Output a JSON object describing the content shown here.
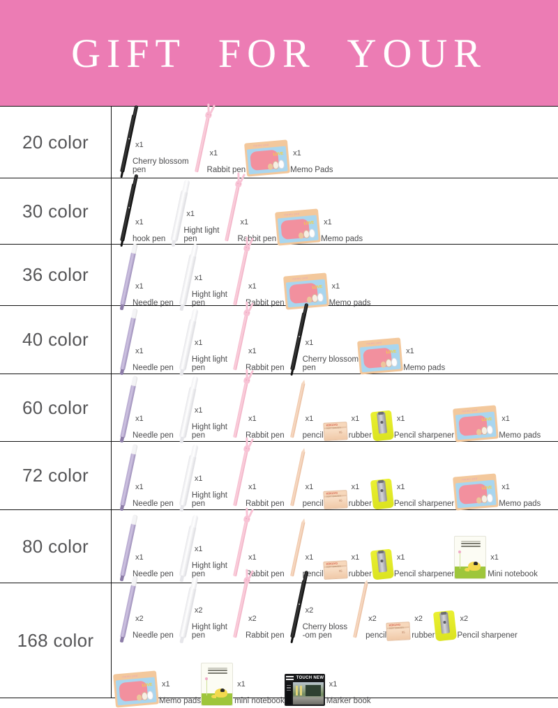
{
  "header": {
    "title": "GIFT  FOR  YOUR",
    "background_color": "#ec7cb4",
    "text_color": "#ffffff"
  },
  "table": {
    "rows": [
      {
        "label": "20 color",
        "lines": [
          [
            {
              "art": "cherry",
              "qty": "x1",
              "name": "Cherry blossom\npen"
            },
            {
              "art": "rabbit",
              "qty": "x1",
              "name": "Rabbit pen"
            },
            {
              "art": "memo",
              "qty": "x1",
              "name": "Memo Pads"
            }
          ]
        ]
      },
      {
        "label": "30 color",
        "lines": [
          [
            {
              "art": "cherry",
              "qty": "x1",
              "name": "hook pen"
            },
            {
              "art": "hlight",
              "qty": "x1",
              "name": "Hight light\npen"
            },
            {
              "art": "rabbit",
              "qty": "x1",
              "name": "Rabbit pen"
            },
            {
              "art": "memo",
              "qty": "x1",
              "name": "Memo pads"
            }
          ]
        ]
      },
      {
        "label": "36 color",
        "lines": [
          [
            {
              "art": "needle",
              "qty": "x1",
              "name": "Needle pen"
            },
            {
              "art": "hlight",
              "qty": "x1",
              "name": "Hight light\npen"
            },
            {
              "art": "rabbit",
              "qty": "x1",
              "name": "Rabbit pen"
            },
            {
              "art": "memo",
              "qty": "x1",
              "name": "Memo pads"
            }
          ]
        ]
      },
      {
        "label": "40 color",
        "lines": [
          [
            {
              "art": "needle",
              "qty": "x1",
              "name": "Needle pen"
            },
            {
              "art": "hlight",
              "qty": "x1",
              "name": "Hight light\npen"
            },
            {
              "art": "rabbit",
              "qty": "x1",
              "name": "Rabbit pen"
            },
            {
              "art": "cherry",
              "qty": "x1",
              "name": "Cherry blossom\npen"
            },
            {
              "art": "memo",
              "qty": "x1",
              "name": "Memo pads"
            }
          ]
        ]
      },
      {
        "label": "60 color",
        "lines": [
          [
            {
              "art": "needle",
              "qty": "x1",
              "name": "Needle pen"
            },
            {
              "art": "hlight",
              "qty": "x1",
              "name": "Hight light\npen"
            },
            {
              "art": "rabbit",
              "qty": "x1",
              "name": "Rabbit pen"
            },
            {
              "art": "pencil",
              "qty": "x1",
              "name": "pencil"
            },
            {
              "art": "rubber",
              "qty": "x1",
              "name": "rubber"
            },
            {
              "art": "sharp",
              "qty": "x1",
              "name": "Pencil sharpener"
            },
            {
              "art": "memo",
              "qty": "x1",
              "name": "Memo pads"
            }
          ]
        ]
      },
      {
        "label": "72 color",
        "lines": [
          [
            {
              "art": "needle",
              "qty": "x1",
              "name": "Needle pen"
            },
            {
              "art": "hlight",
              "qty": "x1",
              "name": "Hight light\npen"
            },
            {
              "art": "rabbit",
              "qty": "x1",
              "name": "Rabbit pen"
            },
            {
              "art": "pencil",
              "qty": "x1",
              "name": "pencil"
            },
            {
              "art": "rubber",
              "qty": "x1",
              "name": "rubber"
            },
            {
              "art": "sharp",
              "qty": "x1",
              "name": "Pencil sharpener"
            },
            {
              "art": "memo",
              "qty": "x1",
              "name": "Memo pads"
            }
          ]
        ]
      },
      {
        "label": "80 color",
        "lines": [
          [
            {
              "art": "needle",
              "qty": "x1",
              "name": "Needle pen"
            },
            {
              "art": "hlight",
              "qty": "x1",
              "name": "Hight light\npen"
            },
            {
              "art": "rabbit",
              "qty": "x1",
              "name": "Rabbit pen"
            },
            {
              "art": "pencil",
              "qty": "x1",
              "name": "pencil"
            },
            {
              "art": "rubber",
              "qty": "x1",
              "name": "rubber"
            },
            {
              "art": "sharp",
              "qty": "x1",
              "name": "Pencil sharpener"
            },
            {
              "art": "mini",
              "qty": "x1",
              "name": "Mini notebook"
            }
          ]
        ]
      },
      {
        "label": "168 color",
        "lines": [
          [
            {
              "art": "needle",
              "qty": "x2",
              "name": "Needle pen"
            },
            {
              "art": "hlight",
              "qty": "x2",
              "name": "Hight light\npen"
            },
            {
              "art": "rabbit",
              "qty": "x2",
              "name": "Rabbit pen"
            },
            {
              "art": "cherry",
              "qty": "x2",
              "name": "Cherry bloss\n-om pen"
            },
            {
              "art": "pencil",
              "qty": "x2",
              "name": "pencil"
            },
            {
              "art": "rubber",
              "qty": "x2",
              "name": "rubber"
            },
            {
              "art": "sharp",
              "qty": "x2",
              "name": "Pencil sharpener"
            }
          ],
          [
            {
              "art": "memo",
              "qty": "x1",
              "name": "Memo pads"
            },
            {
              "art": "mini",
              "qty": "x1",
              "name": "mini notebook"
            },
            {
              "art": "mbook",
              "qty": "x1",
              "name": "Marker book"
            }
          ]
        ]
      }
    ]
  },
  "product_art_labels": {
    "needle": "needle-pen-image",
    "hlight": "highlight-pen-image",
    "rabbit": "rabbit-pen-image",
    "cherry": "cherry-blossom-pen-image",
    "pencil": "pencil-image",
    "rubber": "rubber-eraser-image",
    "sharp": "pencil-sharpener-image",
    "memo": "memo-pads-image",
    "mini": "mini-notebook-image",
    "mbook": "marker-book-image"
  },
  "marker_book_brand": "TOUCH NEW"
}
